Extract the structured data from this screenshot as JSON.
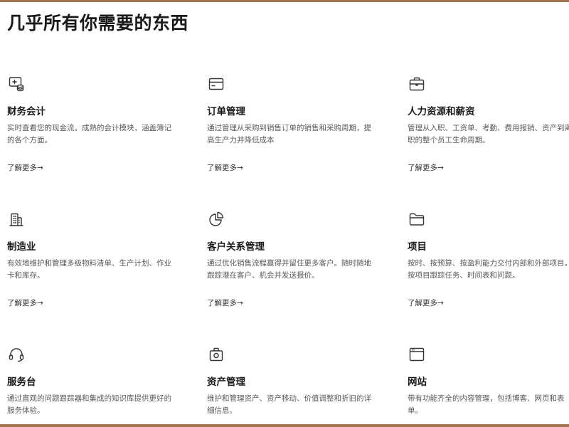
{
  "page": {
    "title": "几乎所有你需要的东西"
  },
  "cards": [
    {
      "icon": "finance-coins-icon",
      "title": "财务会计",
      "desc": "实时查看您的现金流。成熟的会计模块，涵盖簿记的各个方面。",
      "more": "了解更多→"
    },
    {
      "icon": "card-icon",
      "title": "订单管理",
      "desc": "通过管理从采购到销售订单的销售和采购周期，提高生产力并降低成本",
      "more": "了解更多→"
    },
    {
      "icon": "briefcase-icon",
      "title": "人力资源和薪资",
      "desc": "管理从入职、工资单、考勤、费用报销、资产到离职的整个员工生命周期。",
      "more": "了解更多→"
    },
    {
      "icon": "factory-building-icon",
      "title": "制造业",
      "desc": "有效地维护和管理多级物料清单、生产计划、作业卡和库存。",
      "more": "了解更多→"
    },
    {
      "icon": "pie-chart-icon",
      "title": "客户关系管理",
      "desc": "通过优化销售流程赢得并留住更多客户。随时随地跟踪潜在客户、机会并发送报价。",
      "more": "了解更多→"
    },
    {
      "icon": "folder-icon",
      "title": "项目",
      "desc": "按时、按预算、按盈利能力交付内部和外部项目。按项目跟踪任务、时间表和问题。",
      "more": "了解更多→"
    },
    {
      "icon": "headset-icon",
      "title": "服务台",
      "desc": "通过直观的问题跟踪器和集成的知识库提供更好的服务体验。",
      "more": ""
    },
    {
      "icon": "asset-box-icon",
      "title": "资产管理",
      "desc": "维护和管理资产、资产移动、价值调整和折旧的详细信息。",
      "more": ""
    },
    {
      "icon": "browser-window-icon",
      "title": "网站",
      "desc": "带有功能齐全的内容管理，包括博客、网页和表单。",
      "more": ""
    }
  ],
  "colors": {
    "frame": "#a37553",
    "title": "#1a1a1a",
    "body_text": "#5a5a5a",
    "icon_stroke": "#333333"
  }
}
